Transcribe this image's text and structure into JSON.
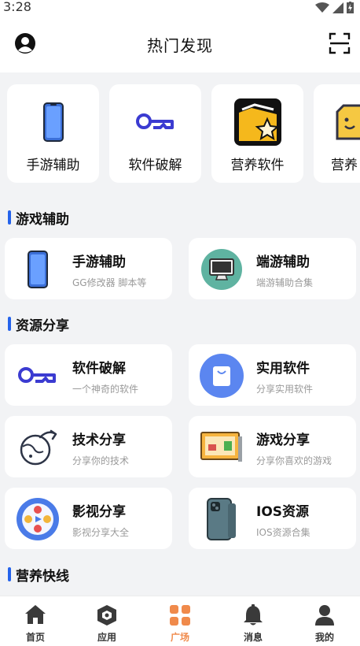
{
  "status_bar": {
    "time": "3:28"
  },
  "header": {
    "title": "热门发现"
  },
  "top_categories": [
    {
      "label": "手游辅助",
      "icon": "phone-icon"
    },
    {
      "label": "软件破解",
      "icon": "key-icon"
    },
    {
      "label": "营养软件",
      "icon": "star-folder-icon"
    },
    {
      "label": "营养",
      "icon": "smile-box-icon"
    }
  ],
  "sections": [
    {
      "title": "游戏辅助",
      "items": [
        {
          "title": "手游辅助",
          "subtitle": "GG修改器 脚本等"
        },
        {
          "title": "端游辅助",
          "subtitle": "端游辅助合集"
        }
      ]
    },
    {
      "title": "资源分享",
      "items": [
        {
          "title": "软件破解",
          "subtitle": "一个神奇的软件"
        },
        {
          "title": "实用软件",
          "subtitle": "分享实用软件"
        },
        {
          "title": "技术分享",
          "subtitle": "分享你的技术"
        },
        {
          "title": "游戏分享",
          "subtitle": "分享你喜欢的游戏"
        },
        {
          "title": "影视分享",
          "subtitle": "影视分享大全"
        },
        {
          "title": "IOS资源",
          "subtitle": "IOS资源合集"
        }
      ]
    },
    {
      "title": "营养快线",
      "items": []
    }
  ],
  "tabbar": {
    "tabs": [
      {
        "label": "首页",
        "icon": "home-icon"
      },
      {
        "label": "应用",
        "icon": "cube-icon"
      },
      {
        "label": "广场",
        "icon": "grid-icon",
        "active": true
      },
      {
        "label": "消息",
        "icon": "bell-icon"
      },
      {
        "label": "我的",
        "icon": "user-icon"
      }
    ]
  },
  "colors": {
    "accent": "#2563eb",
    "active_tab": "#f08a4b"
  }
}
